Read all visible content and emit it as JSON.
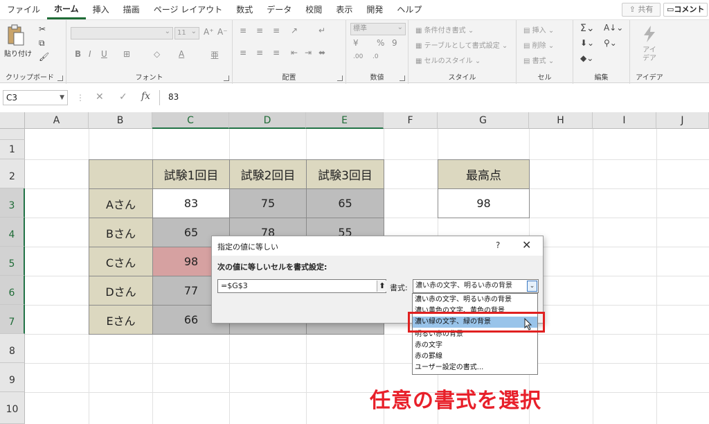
{
  "menu": {
    "items": [
      "ファイル",
      "ホーム",
      "挿入",
      "描画",
      "ページ レイアウト",
      "数式",
      "データ",
      "校閲",
      "表示",
      "開発",
      "ヘルプ"
    ],
    "active": "ホーム",
    "share_label": "共有",
    "comment_label": "コメント"
  },
  "ribbon": {
    "groups": {
      "clipboard": "クリップボード",
      "font": "フォント",
      "alignment": "配置",
      "number": "数値",
      "styles": "スタイル",
      "cells": "セル",
      "editing": "編集",
      "ideas": "アイデア"
    },
    "paste_label": "貼り付け",
    "font_size": "11",
    "number_format": "標準",
    "cond_format": "条件付き書式",
    "table_format": "テーブルとして書式設定",
    "cell_styles": "セルのスタイル",
    "insert": "挿入",
    "delete": "削除",
    "format": "書式",
    "ideas_label": "アイデア",
    "ideas_label_line1": "アイ",
    "ideas_label_line2": "デア"
  },
  "formula_bar": {
    "name_box": "C3",
    "formula": "83",
    "fx_label": "fx"
  },
  "columns": [
    "A",
    "B",
    "C",
    "D",
    "E",
    "F",
    "G",
    "H",
    "I",
    "J"
  ],
  "rows": [
    "1",
    "2",
    "3",
    "4",
    "5",
    "6",
    "7",
    "8",
    "9",
    "10"
  ],
  "table": {
    "headers": [
      "試験1回目",
      "試験2回目",
      "試験3回目"
    ],
    "rows": [
      {
        "name": "Aさん",
        "values": [
          "83",
          "75",
          "65"
        ]
      },
      {
        "name": "Bさん",
        "values": [
          "65",
          "78",
          "55"
        ]
      },
      {
        "name": "Cさん",
        "values": [
          "98",
          "",
          ""
        ]
      },
      {
        "name": "Dさん",
        "values": [
          "77",
          "",
          ""
        ]
      },
      {
        "name": "Eさん",
        "values": [
          "66",
          "54",
          ""
        ]
      }
    ]
  },
  "max_box": {
    "header": "最高点",
    "value": "98"
  },
  "dialog": {
    "title": "指定の値に等しい",
    "help": "?",
    "close": "✕",
    "instruction": "次の値に等しいセルを書式設定:",
    "reference": "=$G$3",
    "format_label": "書式:",
    "selected": "濃い赤の文字、明るい赤の背景"
  },
  "dropdown": {
    "options": [
      "濃い赤の文字、明るい赤の背景",
      "濃い黄色の文字、黄色の背景",
      "濃い緑の文字、緑の背景",
      "明るい赤の背景",
      "赤の文字",
      "赤の罫線",
      "ユーザー設定の書式..."
    ],
    "highlighted_index": 2
  },
  "caption": "任意の書式を選択",
  "colors": {
    "accent_green": "#217346",
    "caption_red": "#e8202a",
    "highlight_blue": "#99c4ea"
  }
}
